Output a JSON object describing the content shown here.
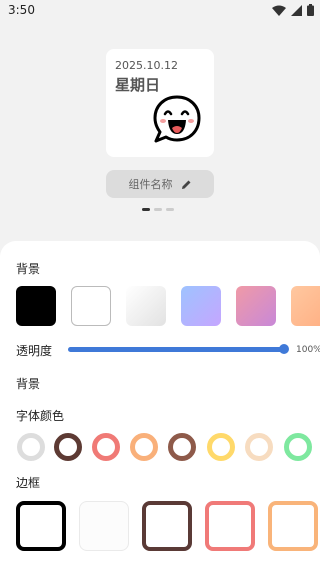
{
  "status_bar": {
    "time": "3:50"
  },
  "preview": {
    "date": "2025.10.12",
    "weekday": "星期日",
    "emoji_icon": "laughing-speech-bubble-icon"
  },
  "widget_name_button": {
    "label": "组件名称",
    "icon": "pencil-icon"
  },
  "page_indicator": {
    "count": 3,
    "active_index": 0
  },
  "panel": {
    "background_label": "背景",
    "background_swatches": [
      "#000000",
      "#ffffff",
      "#f0f0f0",
      "#a8b4ff",
      "#ec8cb0",
      "#ffb98e"
    ],
    "opacity_label": "透明度",
    "opacity_value": "100%",
    "opacity_fraction": 1.0,
    "background_label_2": "背景",
    "font_color_label": "字体颜色",
    "font_colors": [
      "#dddddd",
      "#5d3a33",
      "#f07a76",
      "#f9b07a",
      "#8e5a4a",
      "#ffd96a",
      "#f7dcc0",
      "#7ee89f"
    ],
    "border_label": "边框",
    "border_colors": [
      "#000000",
      "#f2f2f2",
      "#5a3a36",
      "#f07a78",
      "#f9b47a"
    ]
  }
}
